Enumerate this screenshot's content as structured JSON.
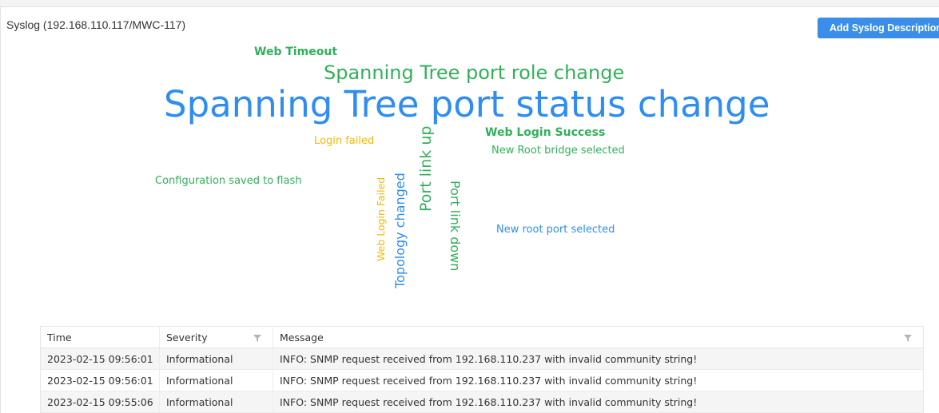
{
  "header": {
    "title": "Syslog (192.168.110.117/MWC-117)",
    "add_button_label": "Add Syslog Description"
  },
  "word_cloud": {
    "words": [
      {
        "text": "Web Timeout",
        "color": "#31b05a"
      },
      {
        "text": "Spanning Tree port role change",
        "color": "#31b05a"
      },
      {
        "text": "Spanning Tree port status change",
        "color": "#2e8ef0"
      },
      {
        "text": "Web Login Success",
        "color": "#31b05a"
      },
      {
        "text": "Login failed",
        "color": "#f5b800"
      },
      {
        "text": "New Root bridge selected",
        "color": "#31b05a"
      },
      {
        "text": "Configuration saved to flash",
        "color": "#31b05a"
      },
      {
        "text": "Web Login Failed",
        "color": "#f5b800"
      },
      {
        "text": "Topology changed",
        "color": "#2e8ef0"
      },
      {
        "text": "Port link up",
        "color": "#31b05a"
      },
      {
        "text": "Port link down",
        "color": "#31b05a"
      },
      {
        "text": "New root port selected",
        "color": "#2e8ef0"
      }
    ]
  },
  "table": {
    "columns": [
      {
        "label": "Time",
        "filterable": false
      },
      {
        "label": "Severity",
        "filterable": true
      },
      {
        "label": "Message",
        "filterable": true
      }
    ],
    "rows": [
      {
        "time": "2023-02-15 09:56:01",
        "severity": "Informational",
        "message": "INFO: SNMP request received from 192.168.110.237 with invalid community string!"
      },
      {
        "time": "2023-02-15 09:56:01",
        "severity": "Informational",
        "message": "INFO: SNMP request received from 192.168.110.237 with invalid community string!"
      },
      {
        "time": "2023-02-15 09:55:06",
        "severity": "Informational",
        "message": "INFO: SNMP request received from 192.168.110.237 with invalid community string!"
      }
    ]
  },
  "icons": {
    "filter": "filter-funnel-icon"
  },
  "colors": {
    "accent_button": "#3a8eea",
    "green": "#31b05a",
    "blue": "#2e8ef0",
    "yellow": "#f5b800"
  }
}
